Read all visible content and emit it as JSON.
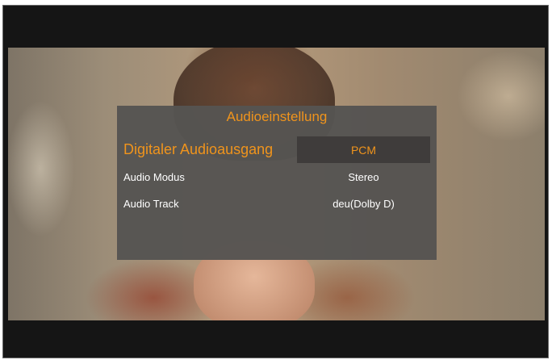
{
  "menu": {
    "title": "Audioeinstellung",
    "rows": [
      {
        "label": "Digitaler Audioausgang",
        "value": "PCM",
        "selected": true
      },
      {
        "label": "Audio Modus",
        "value": "Stereo",
        "selected": false
      },
      {
        "label": "Audio Track",
        "value": "deu(Dolby D)",
        "selected": false
      }
    ]
  },
  "colors": {
    "accent": "#f0941c",
    "panel": "#565452",
    "selected_box": "#3f3c3b",
    "text": "#ffffff"
  }
}
